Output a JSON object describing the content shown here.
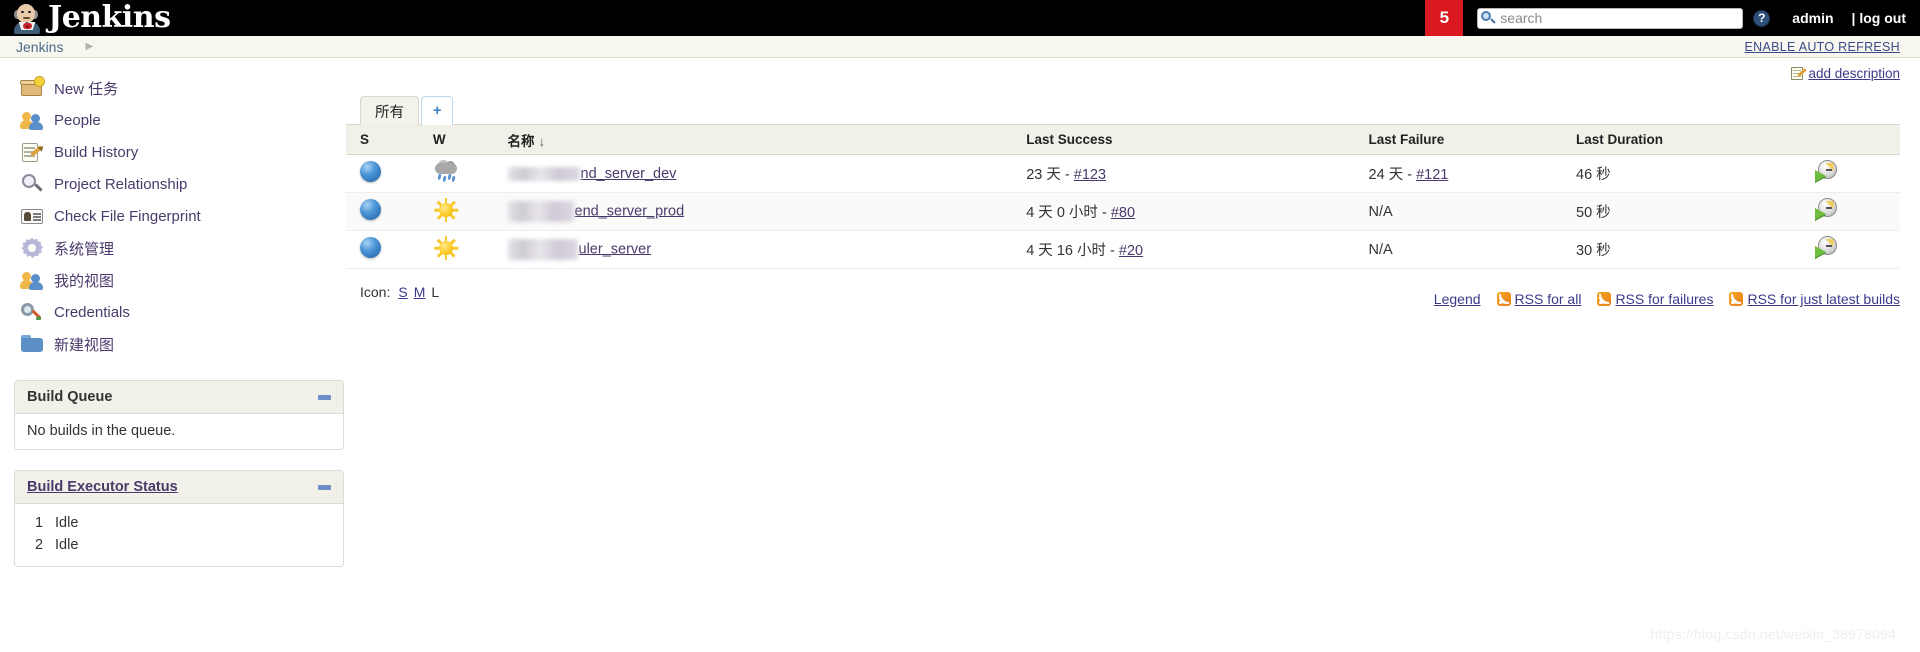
{
  "header": {
    "brand": "Jenkins",
    "notification_count": "5",
    "search_placeholder": "search",
    "search_value": "",
    "help_label": "?",
    "user": "admin",
    "logout": "| log out"
  },
  "breadcrumb": {
    "root": "Jenkins",
    "caret": "▶",
    "auto_refresh": "ENABLE AUTO REFRESH"
  },
  "sidebar": {
    "items": [
      {
        "label": "New 任务",
        "icon": "new-job-icon"
      },
      {
        "label": "People",
        "icon": "people-icon"
      },
      {
        "label": "Build History",
        "icon": "build-history-icon"
      },
      {
        "label": "Project Relationship",
        "icon": "magnifier-icon"
      },
      {
        "label": "Check File Fingerprint",
        "icon": "fingerprint-card-icon"
      },
      {
        "label": "系统管理",
        "icon": "gear-icon"
      },
      {
        "label": "我的视图",
        "icon": "my-views-icon"
      },
      {
        "label": "Credentials",
        "icon": "key-icon"
      },
      {
        "label": "新建视图",
        "icon": "folder-icon"
      }
    ],
    "build_queue": {
      "title": "Build Queue",
      "empty_text": "No builds in the queue."
    },
    "build_executor": {
      "title": "Build Executor Status",
      "executors": [
        {
          "num": "1",
          "status": "Idle"
        },
        {
          "num": "2",
          "status": "Idle"
        }
      ]
    }
  },
  "main": {
    "add_description": "add description",
    "tabs": [
      {
        "label": "所有",
        "active": true
      },
      {
        "label": "+",
        "active": false
      }
    ],
    "table": {
      "headers": {
        "s": "S",
        "w": "W",
        "name": "名称",
        "name_sort": "↓",
        "last_success": "Last Success",
        "last_failure": "Last Failure",
        "last_duration": "Last Duration"
      },
      "rows": [
        {
          "status": "blue",
          "weather": "rainy",
          "name_visible": "nd_server_dev",
          "name_redacted": true,
          "last_success": "23 天 - ",
          "last_success_build": "#123",
          "last_failure": "24 天 - ",
          "last_failure_build": "#121",
          "last_duration": "46 秒"
        },
        {
          "status": "blue",
          "weather": "sunny",
          "name_visible": "end_server_prod",
          "name_redacted": true,
          "last_success": "4 天 0 小时 - ",
          "last_success_build": "#80",
          "last_failure": "N/A",
          "last_failure_build": "",
          "last_duration": "50 秒"
        },
        {
          "status": "blue",
          "weather": "sunny",
          "name_visible": "uler_server",
          "name_redacted": true,
          "last_success": "4 天 16 小时 - ",
          "last_success_build": "#20",
          "last_failure": "N/A",
          "last_failure_build": "",
          "last_duration": "30 秒"
        }
      ]
    },
    "footer": {
      "icon_label": "Icon:",
      "size_small": "S",
      "size_medium": "M",
      "size_large": "L",
      "legend": "Legend",
      "rss_all": "RSS for all",
      "rss_failures": "RSS for failures",
      "rss_latest": "RSS for just latest builds"
    }
  },
  "watermark": "https://blog.csdn.net/weixin_38978094",
  "colors": {
    "header_bg": "#000000",
    "badge_red": "#d9181f",
    "breadcrumb_bg": "#f7f7ef",
    "link": "#3b3a8a",
    "panel_head": "#f1f1ea"
  }
}
